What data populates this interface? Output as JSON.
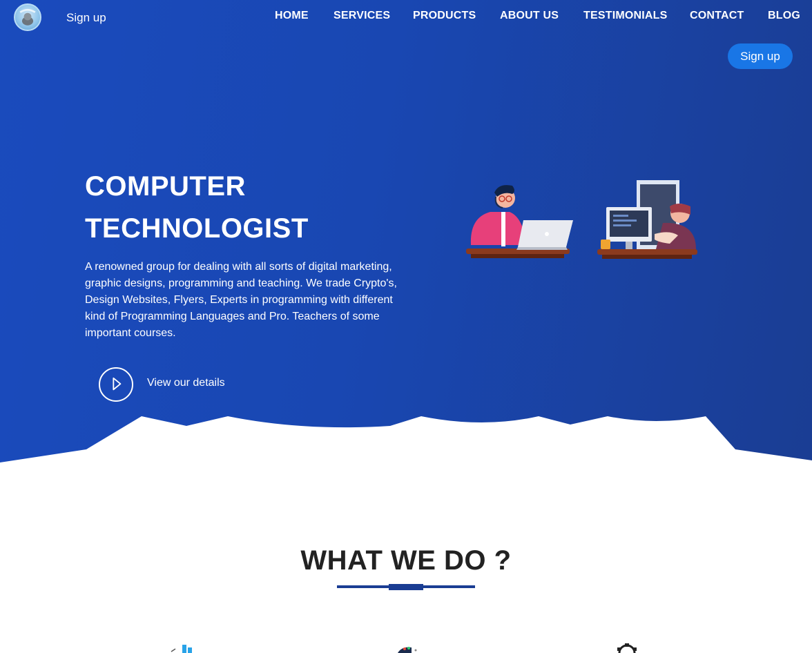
{
  "header": {
    "logo_alt": "logo",
    "signup_link": "Sign up",
    "nav": [
      "HOME",
      "SERVICES",
      "PRODUCTS",
      "ABOUT US",
      "TESTIMONIALS",
      "CONTACT",
      "BLOG"
    ],
    "signup_button": "Sign up"
  },
  "hero": {
    "title_line1": "COMPUTER",
    "title_line2": "TECHNOLOGIST",
    "description": "A renowned group for dealing with all sorts of digital marketing, graphic designs, programming and teaching. We trade Crypto's, Design Websites, Flyers, Experts in programming with different kind of Programming Languages and Pro. Teachers of some important courses.",
    "details_link": "View our details"
  },
  "services": {
    "title": "WHAT WE DO ?",
    "icons": [
      "chart-icon",
      "palette-icon",
      "gear-icon"
    ]
  },
  "colors": {
    "hero_bg": "#1a4bbd",
    "accent_button": "#1976e6",
    "divider": "#1a3d93"
  }
}
